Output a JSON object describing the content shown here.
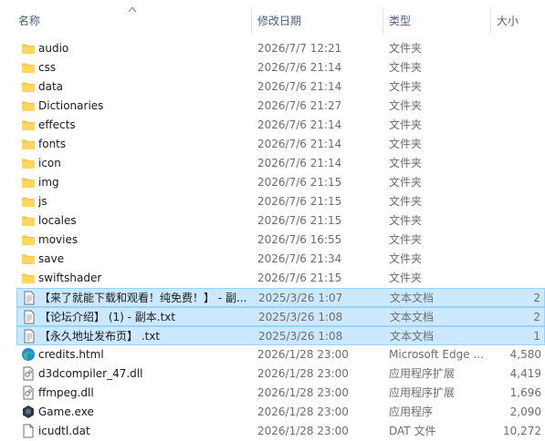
{
  "columns": {
    "name": "名称",
    "date": "修改日期",
    "type": "类型",
    "size": "大小"
  },
  "files": [
    {
      "name": "audio",
      "date": "2026/7/7 12:21",
      "type": "文件夹",
      "size": "",
      "icon": "folder-icon",
      "selected": false
    },
    {
      "name": "css",
      "date": "2026/7/6 21:14",
      "type": "文件夹",
      "size": "",
      "icon": "folder-icon",
      "selected": false
    },
    {
      "name": "data",
      "date": "2026/7/6 21:14",
      "type": "文件夹",
      "size": "",
      "icon": "folder-icon",
      "selected": false
    },
    {
      "name": "Dictionaries",
      "date": "2026/7/6 21:27",
      "type": "文件夹",
      "size": "",
      "icon": "folder-icon",
      "selected": false
    },
    {
      "name": "effects",
      "date": "2026/7/6 21:14",
      "type": "文件夹",
      "size": "",
      "icon": "folder-icon",
      "selected": false
    },
    {
      "name": "fonts",
      "date": "2026/7/6 21:14",
      "type": "文件夹",
      "size": "",
      "icon": "folder-icon",
      "selected": false
    },
    {
      "name": "icon",
      "date": "2026/7/6 21:14",
      "type": "文件夹",
      "size": "",
      "icon": "folder-icon",
      "selected": false
    },
    {
      "name": "img",
      "date": "2026/7/6 21:15",
      "type": "文件夹",
      "size": "",
      "icon": "folder-icon",
      "selected": false
    },
    {
      "name": "js",
      "date": "2026/7/6 21:15",
      "type": "文件夹",
      "size": "",
      "icon": "folder-icon",
      "selected": false
    },
    {
      "name": "locales",
      "date": "2026/7/6 21:15",
      "type": "文件夹",
      "size": "",
      "icon": "folder-icon",
      "selected": false
    },
    {
      "name": "movies",
      "date": "2026/7/6 16:55",
      "type": "文件夹",
      "size": "",
      "icon": "folder-icon",
      "selected": false
    },
    {
      "name": "save",
      "date": "2026/7/6 21:34",
      "type": "文件夹",
      "size": "",
      "icon": "folder-icon",
      "selected": false
    },
    {
      "name": "swiftshader",
      "date": "2026/7/6 21:15",
      "type": "文件夹",
      "size": "",
      "icon": "folder-icon",
      "selected": false
    },
    {
      "name": "【来了就能下载和观看！纯免费！】 - 副...",
      "date": "2025/3/26 1:07",
      "type": "文本文档",
      "size": "2",
      "icon": "text-document-icon",
      "selected": true
    },
    {
      "name": "【论坛介绍】 (1) - 副本.txt",
      "date": "2025/3/26 1:08",
      "type": "文本文档",
      "size": "2",
      "icon": "text-document-icon",
      "selected": true
    },
    {
      "name": "【永久地址发布页】 .txt",
      "date": "2025/3/26 1:08",
      "type": "文本文档",
      "size": "1",
      "icon": "text-document-icon",
      "selected": true
    },
    {
      "name": "credits.html",
      "date": "2026/1/28 23:00",
      "type": "Microsoft Edge ...",
      "size": "4,580",
      "icon": "edge-html-icon",
      "selected": false
    },
    {
      "name": "d3dcompiler_47.dll",
      "date": "2026/1/28 23:00",
      "type": "应用程序扩展",
      "size": "4,419",
      "icon": "dll-file-icon",
      "selected": false
    },
    {
      "name": "ffmpeg.dll",
      "date": "2026/1/28 23:00",
      "type": "应用程序扩展",
      "size": "1,696",
      "icon": "dll-file-icon",
      "selected": false
    },
    {
      "name": "Game.exe",
      "date": "2026/1/28 23:00",
      "type": "应用程序",
      "size": "2,090",
      "icon": "game-exe-icon",
      "selected": false
    },
    {
      "name": "icudtl.dat",
      "date": "2026/1/28 23:00",
      "type": "DAT 文件",
      "size": "10,272",
      "icon": "dat-file-icon",
      "selected": false
    }
  ]
}
